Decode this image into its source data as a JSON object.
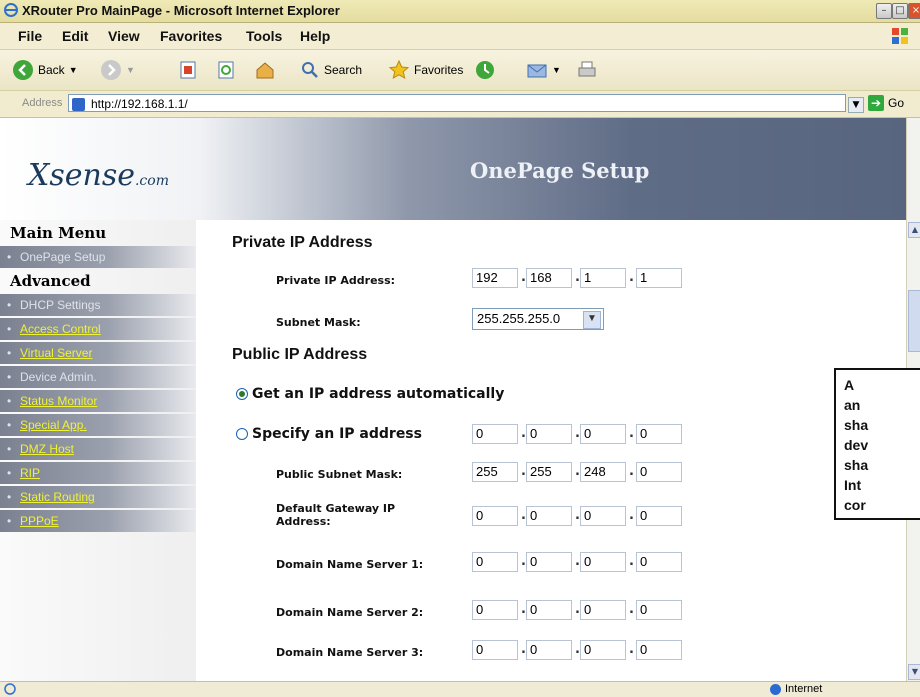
{
  "window": {
    "title": "XRouter Pro MainPage - Microsoft Internet Explorer"
  },
  "menu": [
    "File",
    "Edit",
    "View",
    "Favorites",
    "Tools",
    "Help"
  ],
  "toolbar": {
    "back": "Back",
    "search": "Search",
    "favorites": "Favorites"
  },
  "address": {
    "label": "Address",
    "url": "http://192.168.1.1/",
    "go": "Go"
  },
  "banner": {
    "logo": "Xsense",
    "logo_suffix": ".com",
    "title": "OnePage Setup"
  },
  "sidebar": {
    "main_heading": "Main Menu",
    "main_items": [
      "OnePage Setup"
    ],
    "advanced_heading": "Advanced",
    "advanced_items": [
      "DHCP Settings",
      "Access Control",
      "Virtual Server",
      "Device Admin.",
      "Status Monitor",
      "Special App.",
      "DMZ Host",
      "RIP",
      "Static Routing",
      "PPPoE"
    ]
  },
  "private": {
    "heading": "Private IP Address",
    "ip_label": "Private IP Address:",
    "ip": [
      "192",
      "168",
      "1",
      "1"
    ],
    "mask_label": "Subnet Mask:",
    "mask_value": "255.255.255.0"
  },
  "public": {
    "heading": "Public IP Address",
    "auto_label": "Get an IP address automatically",
    "specify_label": "Specify an IP address",
    "specify_ip": [
      "0",
      "0",
      "0",
      "0"
    ],
    "subnet_label": "Public Subnet Mask:",
    "subnet": [
      "255",
      "255",
      "248",
      "0"
    ],
    "gateway_label": "Default Gateway IP Address:",
    "gateway": [
      "0",
      "0",
      "0",
      "0"
    ],
    "dns1_label": "Domain Name Server 1:",
    "dns1": [
      "0",
      "0",
      "0",
      "0"
    ],
    "dns2_label": "Domain Name Server 2:",
    "dns2": [
      "0",
      "0",
      "0",
      "0"
    ],
    "dns3_label": "Domain Name Server 3:",
    "dns3": [
      "0",
      "0",
      "0",
      "0"
    ]
  },
  "callout": {
    "lines": [
      "A",
      "an",
      "sha",
      "dev",
      "sha",
      "Int",
      "cor"
    ]
  },
  "status": {
    "zone": "Internet"
  }
}
